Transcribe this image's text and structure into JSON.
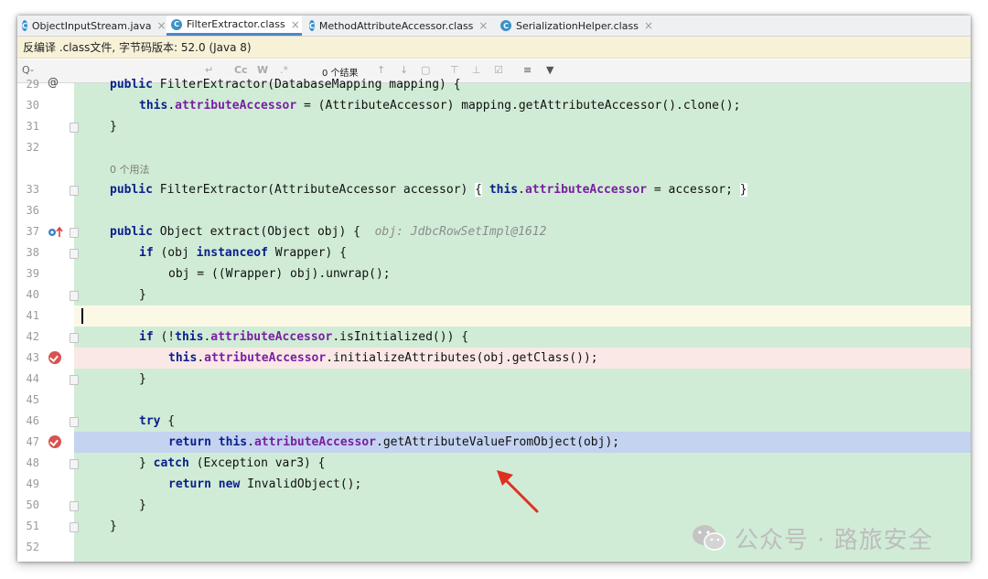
{
  "tabs": [
    {
      "label": "ObjectInputStream.java",
      "active": false
    },
    {
      "label": "FilterExtractor.class",
      "active": true
    },
    {
      "label": "MethodAttributeAccessor.class",
      "active": false
    },
    {
      "label": "SerializationHelper.class",
      "active": false
    }
  ],
  "banner": {
    "text": "反编译 .class文件, 字节码版本: 52.0 (Java 8)"
  },
  "search": {
    "placeholder": "Q-",
    "results": "0 个结果",
    "cc": "Cc",
    "w": "W",
    "regex": ".*"
  },
  "editor": {
    "line_numbers": {
      "l29": "29",
      "l30": "30",
      "l31": "31",
      "l32": "32",
      "l33": "33",
      "l36": "36",
      "l37": "37",
      "l38": "38",
      "l39": "39",
      "l40": "40",
      "l41": "41",
      "l42": "42",
      "l43": "43",
      "l44": "44",
      "l45": "45",
      "l46": "46",
      "l47": "47",
      "l48": "48",
      "l49": "49",
      "l50": "50",
      "l51": "51",
      "l52": "52"
    },
    "usage_hint": "0 个用法",
    "inline_hint": "obj: JdbcRowSetImpl@1612",
    "tokens": {
      "public": "public",
      "this": "this",
      "if": "if",
      "instanceof": "instanceof",
      "return": "return",
      "try": "try",
      "catch": "catch",
      "new": "new",
      "field": "attributeAccessor",
      "l29_rest": " FilterExtractor(DatabaseMapping mapping) {",
      "l30_rest": " = (AttributeAccessor) mapping.getAttributeAccessor().clone();",
      "l31": "}",
      "l33_sig": " FilterExtractor(AttributeAccessor accessor) ",
      "l33_ob": "{",
      "l33_rest": " = accessor;",
      "l33_cb": "}",
      "l37_rest": " Object extract(Object obj) {  ",
      "l38_a": " (obj ",
      "l38_b": " Wrapper) {",
      "l39": "obj = ((Wrapper) obj).unwrap();",
      "l40": "}",
      "l42_a": " (!",
      "l42_b": ".isInitialized()) {",
      "l43_rest": ".initializeAttributes(obj.getClass());",
      "l44": "}",
      "l46_rest": " {",
      "l47_rest": ".getAttributeValueFromObject(obj);",
      "l48_a": "} ",
      "l48_b": " (Exception var3) {",
      "l49_rest": " InvalidObject();",
      "l50": "}",
      "l51": "}"
    }
  },
  "watermark": {
    "text": "公众号 · 路旅安全"
  },
  "colors": {
    "code_bg": "#d0ecd6",
    "caret_line": "#fcf8e6",
    "breakpoint_line": "#fae8e6",
    "exec_line": "#c3d3f0",
    "keyword": "#0b1e8c",
    "field": "#7a1fa2",
    "arrow": "#e03020"
  }
}
